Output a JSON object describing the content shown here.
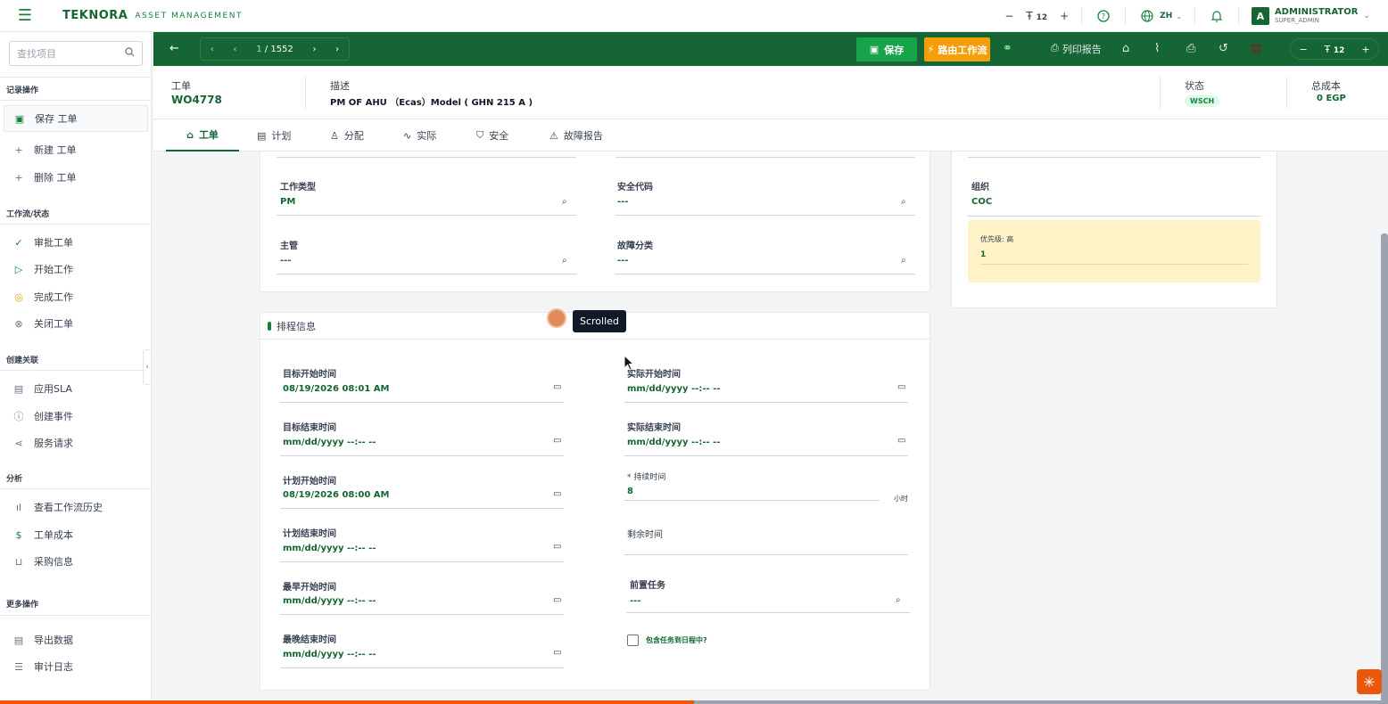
{
  "topbar": {
    "logo": "TEKNORA",
    "logo_sub": "ASSET MANAGEMENT",
    "font_minus": "−",
    "font_size": "12",
    "font_plus": "+",
    "lang": "ZH",
    "avatar_letter": "A",
    "user_name": "ADMINISTRATOR",
    "user_role": "SUPER_ADMIN"
  },
  "sidebar": {
    "search_placeholder": "查找项目",
    "sections": {
      "record_ops": "记录操作",
      "workflow": "工作流/状态",
      "create_link": "创建关联",
      "analysis": "分析",
      "more_ops": "更多操作"
    },
    "items": {
      "save": "保存 工单",
      "new": "新建 工单",
      "delete": "删除 工单",
      "approve": "审批工单",
      "start": "开始工作",
      "complete": "完成工作",
      "close": "关闭工单",
      "apply_sla": "应用SLA",
      "create_event": "创建事件",
      "service_request": "服务请求",
      "view_history": "查看工作流历史",
      "wo_cost": "工单成本",
      "purchase_info": "采购信息",
      "export": "导出数据",
      "audit": "审计日志"
    }
  },
  "toolbar": {
    "page_current": "1",
    "page_total": "/ 1552",
    "save_label": "保存",
    "route_label": "路由工作流",
    "print_report_label": "列印报告",
    "zoom_size": "12"
  },
  "header": {
    "wo_label": "工单",
    "wo_value": "WO4778",
    "desc_label": "描述",
    "desc_value": "PM OF AHU （Ecas）Model ( GHN 215 A )",
    "status_label": "状态",
    "status_value": "WSCH",
    "cost_label": "总成本",
    "cost_value": "0 EGP"
  },
  "tabs": {
    "workorder": "工单",
    "plan": "计划",
    "assign": "分配",
    "actual": "实际",
    "safety": "安全",
    "failure": "故障报告"
  },
  "details": {
    "work_type_label": "工作类型",
    "work_type_value": "PM",
    "safety_code_label": "安全代码",
    "safety_code_value": "---",
    "supervisor_label": "主管",
    "supervisor_value": "---",
    "failure_class_label": "故障分类",
    "failure_class_value": "---",
    "org_label": "组织",
    "org_value": "COC",
    "priority_label": "优先级: 高",
    "priority_value": "1"
  },
  "schedule": {
    "title": "排程信息",
    "target_start_label": "目标开始时间",
    "target_start_value": "08/19/2026 08:01 AM",
    "actual_start_label": "实际开始时间",
    "actual_start_value": "mm/dd/yyyy --:-- --",
    "target_end_label": "目标结束时间",
    "target_end_value": "mm/dd/yyyy --:-- --",
    "actual_end_label": "实际结束时间",
    "actual_end_value": "mm/dd/yyyy --:-- --",
    "plan_start_label": "计划开始时间",
    "plan_start_value": "08/19/2026 08:00 AM",
    "duration_label": "* 持续时间",
    "duration_value": "8",
    "duration_unit": "小时",
    "plan_end_label": "计划结束时间",
    "plan_end_value": "mm/dd/yyyy --:-- --",
    "remaining_label": "剩余时间",
    "earliest_start_label": "最早开始时间",
    "earliest_start_value": "mm/dd/yyyy --:-- --",
    "predecessor_label": "前置任务",
    "predecessor_value": "---",
    "latest_end_label": "最晚结束时间",
    "latest_end_value": "mm/dd/yyyy --:-- --",
    "include_label": "包含任务到日程中?"
  },
  "overlay": {
    "tooltip": "Scrolled"
  },
  "progress": {
    "fraction": 0.5
  },
  "colors": {
    "primary": "#166534",
    "accent": "#f59e0b",
    "save": "#16a34a"
  }
}
